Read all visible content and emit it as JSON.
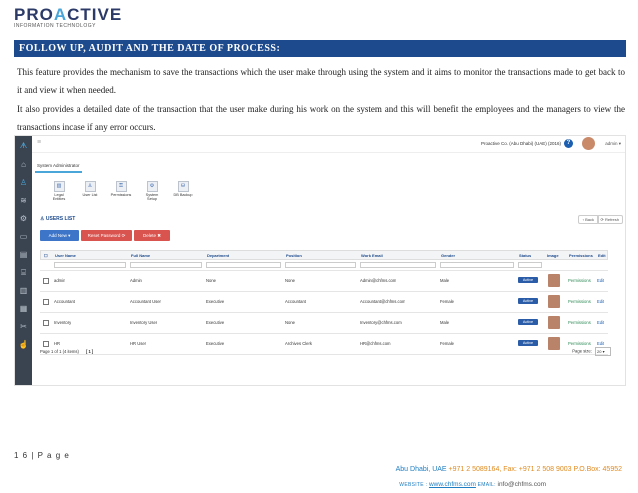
{
  "logo": {
    "name_part1": "PRO",
    "name_v": "A",
    "name_part2": "CTIVE",
    "subtitle": "INFORMATION TECHNOLOGY"
  },
  "section_heading": "FOLLOW UP, AUDIT AND THE DATE OF PROCESS:",
  "paragraphs": [
    "This feature provides the mechanism to save the transactions which the user make through using the system and it aims to monitor the transactions made to get back to it and view it when needed.",
    "It also provides a detailed date of the transaction that the user make during his work on the system and this will benefit the employees and the managers to view the transactions incase if any error occurs."
  ],
  "app": {
    "topbar": {
      "menu_icon": "hamburger-icon",
      "org": "Proactive Co. (Abu Dhabi) (UAE) (2016)",
      "help": "?",
      "user": "admin"
    },
    "tab": "System Administrator",
    "toolbar": [
      {
        "label": "Legal Entities",
        "icon": "building-icon"
      },
      {
        "label": "User List",
        "icon": "users-icon"
      },
      {
        "label": "Permissions",
        "icon": "key-icon"
      },
      {
        "label": "System Setup",
        "icon": "gear-icon"
      },
      {
        "label": "DB Backup",
        "icon": "database-icon"
      }
    ],
    "list_title": "USERS LIST",
    "back": "Back",
    "refresh": "Refresh",
    "buttons": {
      "add_new": "Add New ▾",
      "reset_password": "Reset Password ⟳",
      "delete": "Delete ✖"
    },
    "columns": [
      "User Name",
      "Full Name",
      "Department",
      "Position",
      "Work Email",
      "Gender",
      "Status",
      "Image",
      "Permissions",
      "Edit"
    ],
    "rows": [
      {
        "user": "admin",
        "full": "Admin",
        "dept": "None",
        "pos": "None",
        "email": "Admin@chfms.com",
        "gender": "Male",
        "status": "Active",
        "perm": "Permissions",
        "edit": "Edit"
      },
      {
        "user": "Accountant",
        "full": "Accountant User",
        "dept": "Executive",
        "pos": "Accountant",
        "email": "Accountant@chfms.com",
        "gender": "Female",
        "status": "Active",
        "perm": "Permissions",
        "edit": "Edit"
      },
      {
        "user": "Inventory",
        "full": "Inventory User",
        "dept": "Executive",
        "pos": "None",
        "email": "Inventory@chfms.com",
        "gender": "Male",
        "status": "Active",
        "perm": "Permissions",
        "edit": "Edit"
      },
      {
        "user": "HR",
        "full": "HR User",
        "dept": "Executive",
        "pos": "Archives Clerk",
        "email": "HR@chfms.com",
        "gender": "Female",
        "status": "Active",
        "perm": "Permissions",
        "edit": "Edit"
      }
    ],
    "pager": {
      "text": "Page 1 of 1 (4 items)",
      "nav": "[1]",
      "page_size_label": "Page size:",
      "page_size": "20"
    }
  },
  "footer": {
    "page_number": "1 6  |  P a g e",
    "address_label": "Abu Dhabi, UAE",
    "address": " +971 2 5089164, Fax: +971 2 508 9003  P.O.Box: 45952",
    "website_label": "WEBSITE : ",
    "website": "www.chfms.com",
    "email_label": "  EMAIL: ",
    "email": "info@chfms.com"
  }
}
